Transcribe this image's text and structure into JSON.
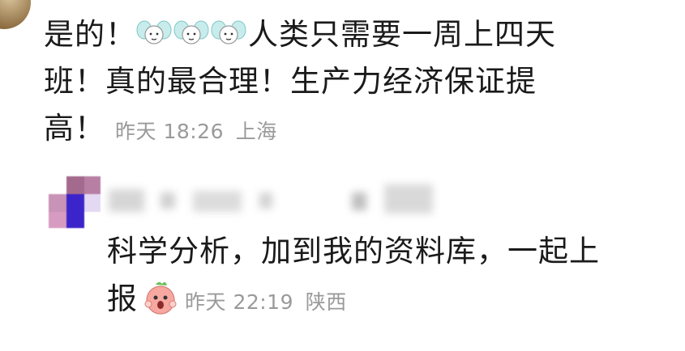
{
  "comment_top": {
    "text_before_stickers": "是的！",
    "stickers": [
      "angel-emoji",
      "angel-emoji",
      "angel-emoji"
    ],
    "line1_rest": "人类只需要一周上四天",
    "line2": "班！真的最合理！生产力经济保证提",
    "line3": "高！",
    "time": "昨天 18:26",
    "location": "上海"
  },
  "comment_bottom": {
    "line1": "科学分析，加到我的资料库，一起上",
    "line2": "报",
    "sticker": "peach-scream-emoji",
    "time": "昨天 22:19",
    "location": "陕西"
  },
  "colors": {
    "text": "#1a1a1a",
    "meta": "#9a9a9a",
    "accent_avatar": "#3b24c9"
  }
}
